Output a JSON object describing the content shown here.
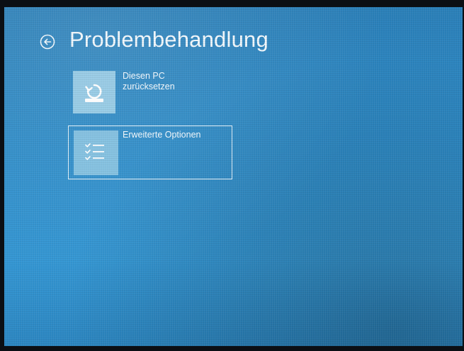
{
  "screen": {
    "title": "Problembehandlung",
    "back_icon": "back-arrow-circle-icon"
  },
  "options": [
    {
      "label_line1": "Diesen PC",
      "label_line2": "zurücksetzen",
      "icon": "reset-pc-icon"
    },
    {
      "label_line1": "Erweiterte Optionen",
      "icon": "checklist-icon",
      "selected": true
    }
  ],
  "colors": {
    "background": "#2d8bc7",
    "tile": "#aad7eb",
    "text": "#ffffff"
  }
}
